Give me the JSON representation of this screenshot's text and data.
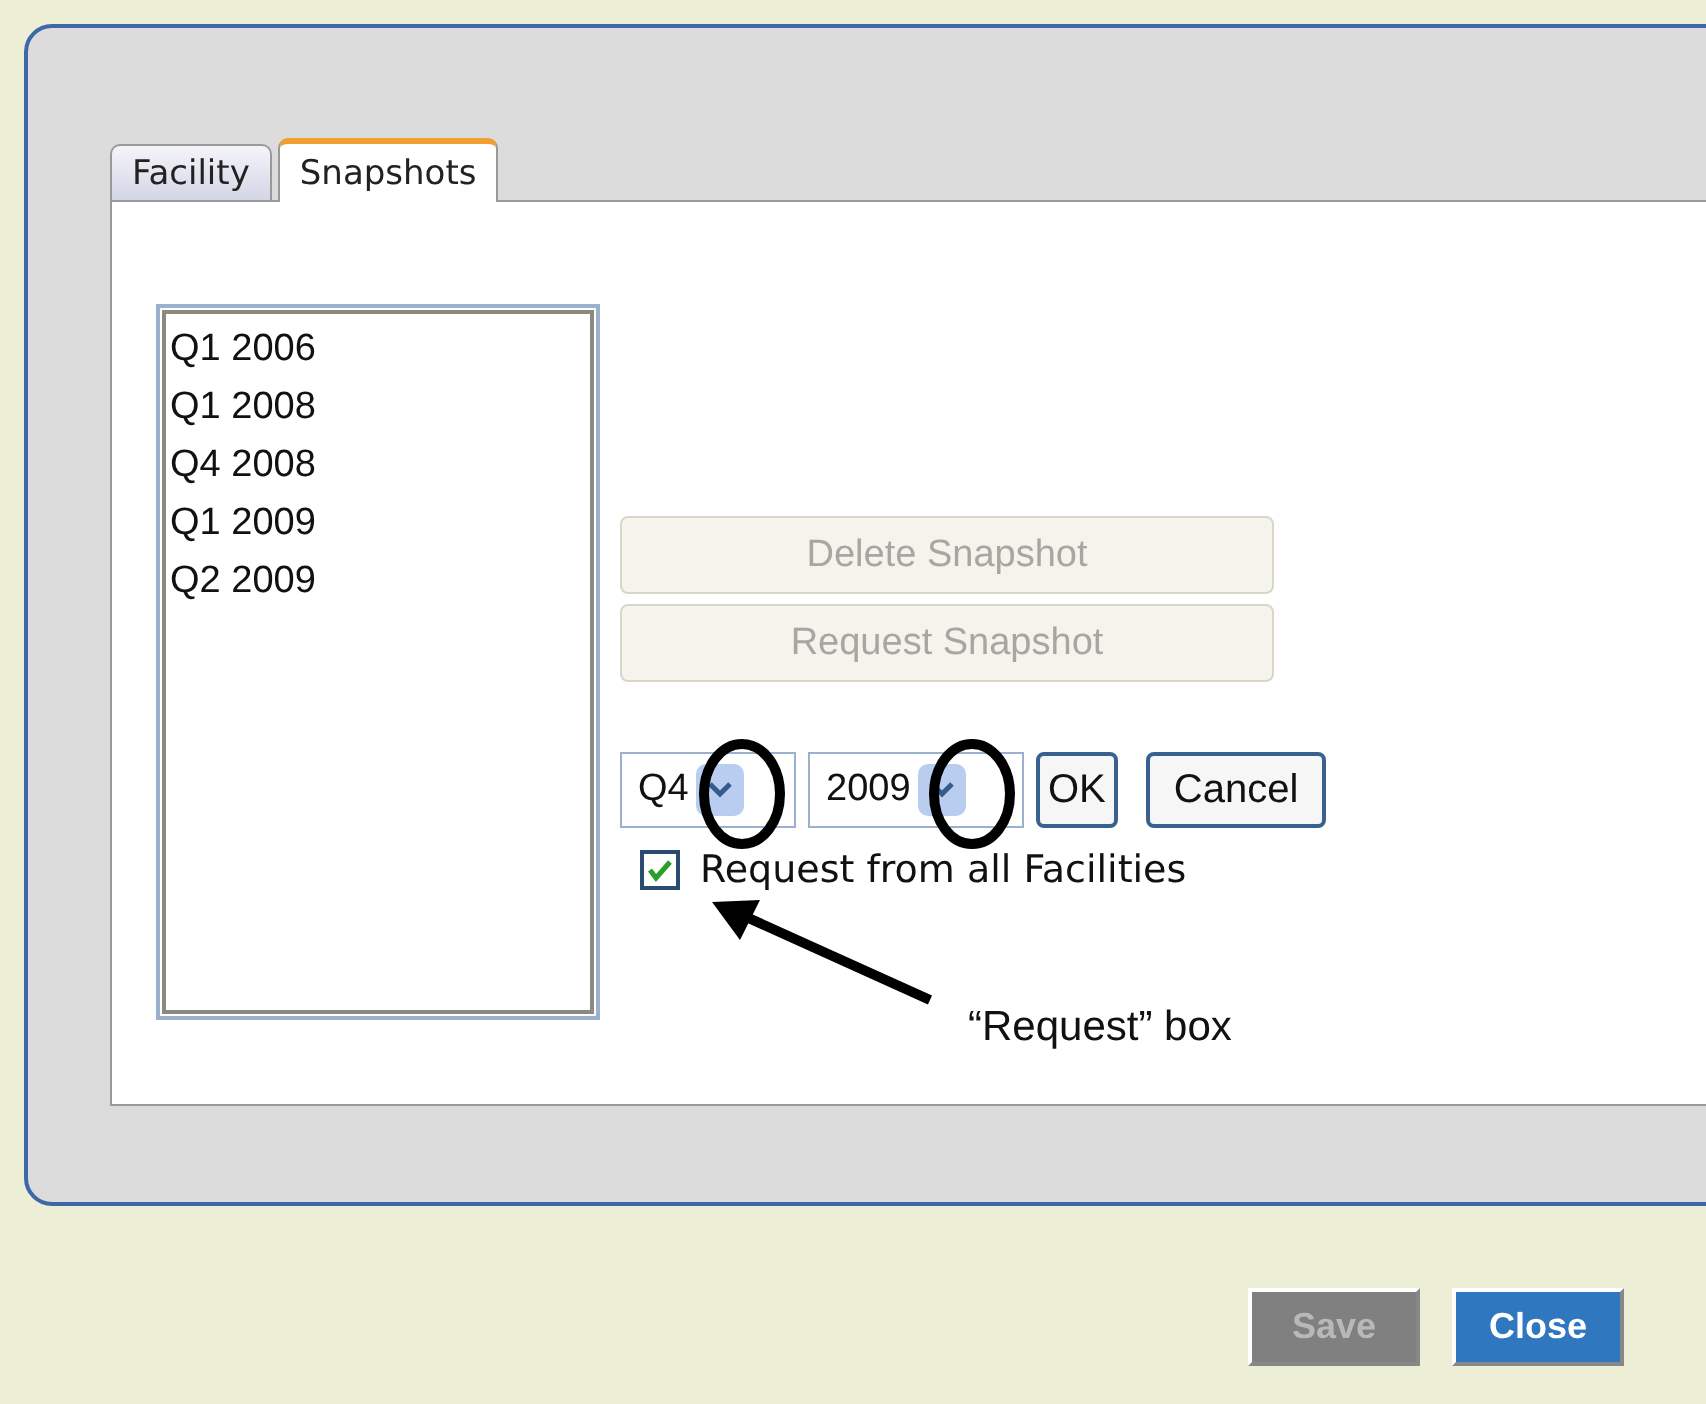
{
  "tabs": [
    {
      "label": "Facility",
      "selected": false
    },
    {
      "label": "Snapshots",
      "selected": true
    }
  ],
  "snapshots": [
    "Q1 2006",
    "Q1 2008",
    "Q4 2008",
    "Q1 2009",
    "Q2 2009"
  ],
  "snapshot_buttons": [
    {
      "label": "Delete Snapshot",
      "disabled": true
    },
    {
      "label": "Request Snapshot",
      "disabled": true
    }
  ],
  "quarter_select": {
    "value": "Q4"
  },
  "year_select": {
    "value": "2009"
  },
  "ok_button": "OK",
  "cancel_button": "Cancel",
  "request_all": {
    "label": "Request from all Facilities",
    "checked": true
  },
  "annotation": "“Request” box",
  "footer_buttons": [
    {
      "label": "Save",
      "disabled": true
    },
    {
      "label": "Close",
      "disabled": false
    }
  ]
}
